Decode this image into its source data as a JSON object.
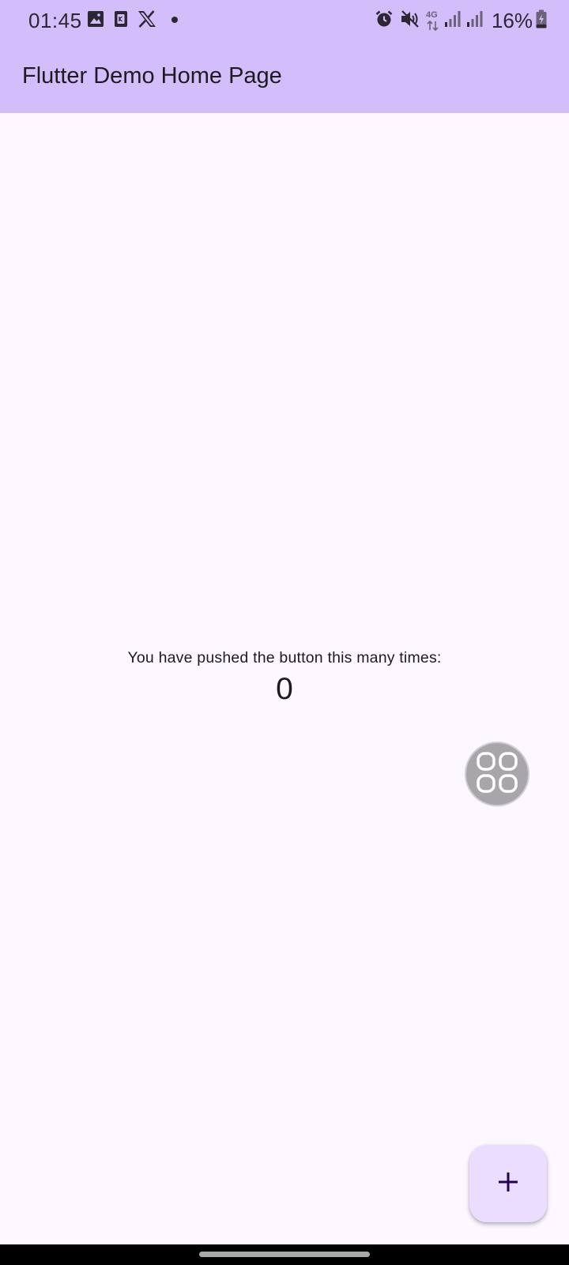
{
  "status_bar": {
    "time": "01:45",
    "battery": "16%",
    "left_icons": [
      "gallery-icon",
      "sim-icon",
      "x-app-icon",
      "notification-dot-icon"
    ],
    "right_icons": [
      "alarm-icon",
      "muted-icon",
      "4g-data-icon",
      "signal-icon",
      "signal-icon",
      "battery-charging-icon"
    ],
    "network_label": "4G"
  },
  "app_bar": {
    "title": "Flutter Demo Home Page"
  },
  "counter": {
    "label": "You have pushed the button this many times:",
    "value": "0"
  },
  "floating_launcher": {
    "icon": "grid-icon"
  },
  "fab": {
    "icon": "plus-icon"
  },
  "colors": {
    "app_bar": "#d3bdfb",
    "background": "#fdf7ff",
    "fab": "#eaddff",
    "nav_bar": "#000000"
  }
}
